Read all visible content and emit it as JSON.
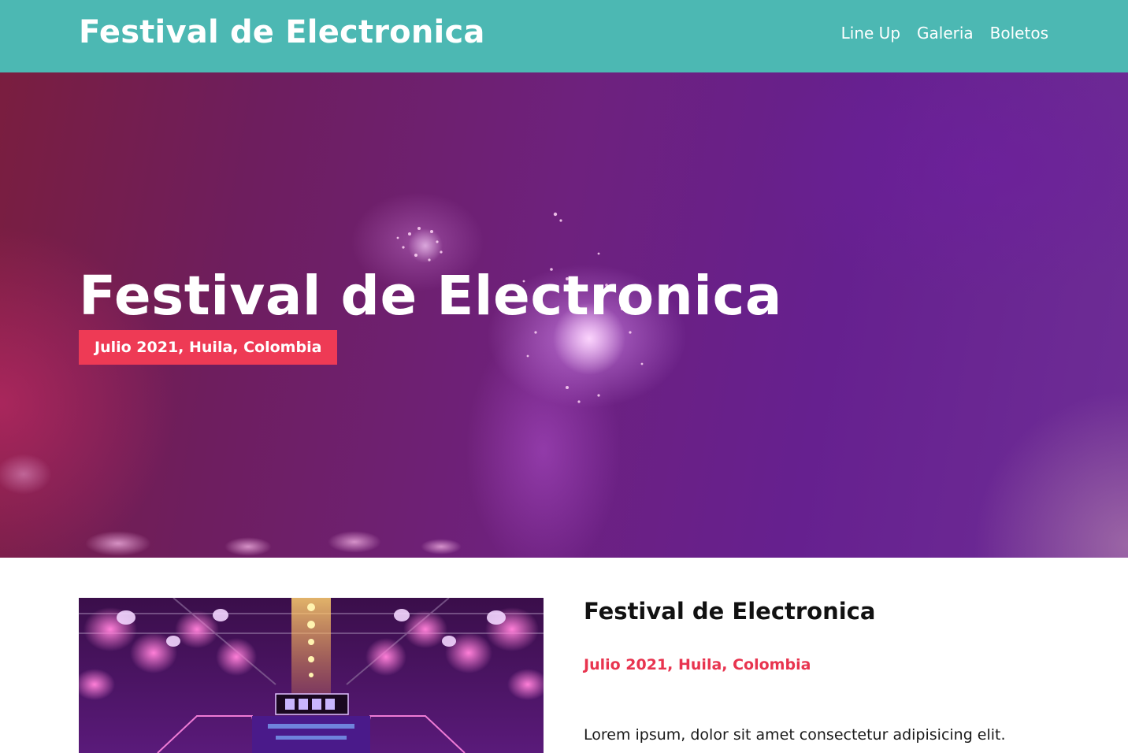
{
  "header": {
    "logo": "Festival de Electronica",
    "nav": [
      {
        "label": "Line Up"
      },
      {
        "label": "Galeria"
      },
      {
        "label": "Boletos"
      }
    ],
    "background_color": "#4cb8b3"
  },
  "hero": {
    "title": "Festival de Electronica",
    "badge": "Julio 2021, Huila, Colombia",
    "badge_color": "#ee3a55",
    "image": "fireworks-concert-photo"
  },
  "event": {
    "title": "Festival de Electronica",
    "date": "Julio 2021, Huila, Colombia",
    "description": "Lorem ipsum, dolor sit amet consectetur adipisicing elit.",
    "image": "concert-stage-photo",
    "date_color": "#e8344f"
  }
}
